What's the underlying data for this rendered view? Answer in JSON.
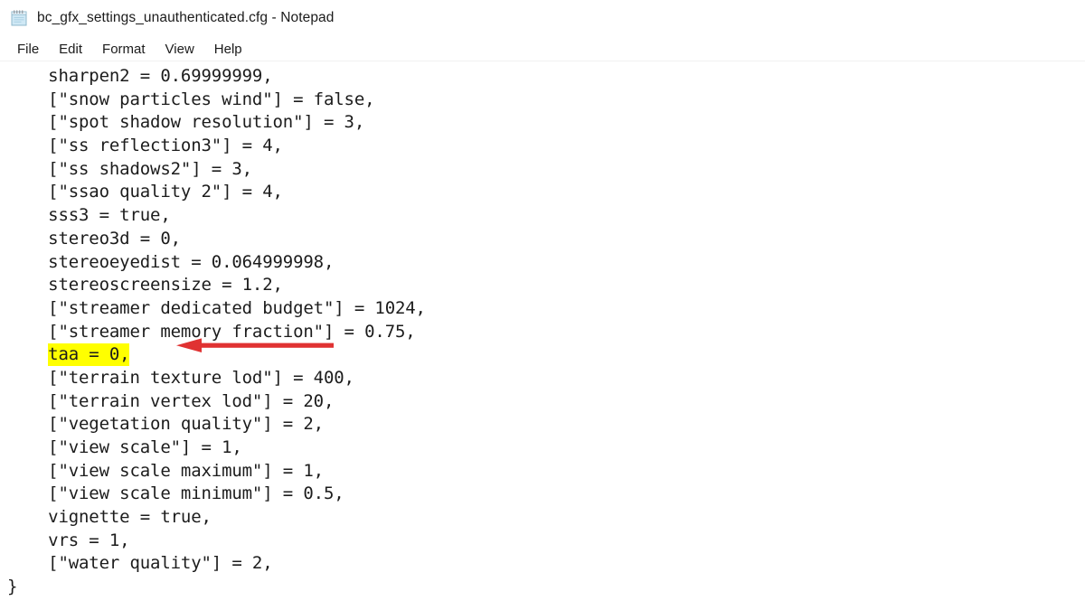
{
  "window": {
    "title": "bc_gfx_settings_unauthenticated.cfg - Notepad",
    "icon": "notepad-icon"
  },
  "menubar": {
    "items": [
      {
        "label": "File"
      },
      {
        "label": "Edit"
      },
      {
        "label": "Format"
      },
      {
        "label": "View"
      },
      {
        "label": "Help"
      }
    ]
  },
  "editor": {
    "font_size_px": 19,
    "text_color": "#1c1c1c",
    "background": "#ffffff",
    "highlight_color": "#ffff00",
    "lines": [
      {
        "text": "    sharpen2 = 0.69999999,",
        "highlight": false
      },
      {
        "text": "    [\"snow particles wind\"] = false,",
        "highlight": false
      },
      {
        "text": "    [\"spot shadow resolution\"] = 3,",
        "highlight": false
      },
      {
        "text": "    [\"ss reflection3\"] = 4,",
        "highlight": false
      },
      {
        "text": "    [\"ss shadows2\"] = 3,",
        "highlight": false
      },
      {
        "text": "    [\"ssao quality 2\"] = 4,",
        "highlight": false
      },
      {
        "text": "    sss3 = true,",
        "highlight": false
      },
      {
        "text": "    stereo3d = 0,",
        "highlight": false
      },
      {
        "text": "    stereoeyedist = 0.064999998,",
        "highlight": false
      },
      {
        "text": "    stereoscreensize = 1.2,",
        "highlight": false
      },
      {
        "text": "    [\"streamer dedicated budget\"] = 1024,",
        "highlight": false
      },
      {
        "text": "    [\"streamer memory fraction\"] = 0.75,",
        "highlight": false
      },
      {
        "text": "    taa = 0,",
        "highlight": true
      },
      {
        "text": "    [\"terrain texture lod\"] = 400,",
        "highlight": false
      },
      {
        "text": "    [\"terrain vertex lod\"] = 20,",
        "highlight": false
      },
      {
        "text": "    [\"vegetation quality\"] = 2,",
        "highlight": false
      },
      {
        "text": "    [\"view scale\"] = 1,",
        "highlight": false
      },
      {
        "text": "    [\"view scale maximum\"] = 1,",
        "highlight": false
      },
      {
        "text": "    [\"view scale minimum\"] = 0.5,",
        "highlight": false
      },
      {
        "text": "    vignette = true,",
        "highlight": false
      },
      {
        "text": "    vrs = 1,",
        "highlight": false
      },
      {
        "text": "    [\"water quality\"] = 2,",
        "highlight": false
      },
      {
        "text": "}",
        "highlight": false
      }
    ]
  },
  "annotation": {
    "type": "arrow",
    "direction": "left",
    "color": "#e03232",
    "points_to": "taa = 0,"
  }
}
